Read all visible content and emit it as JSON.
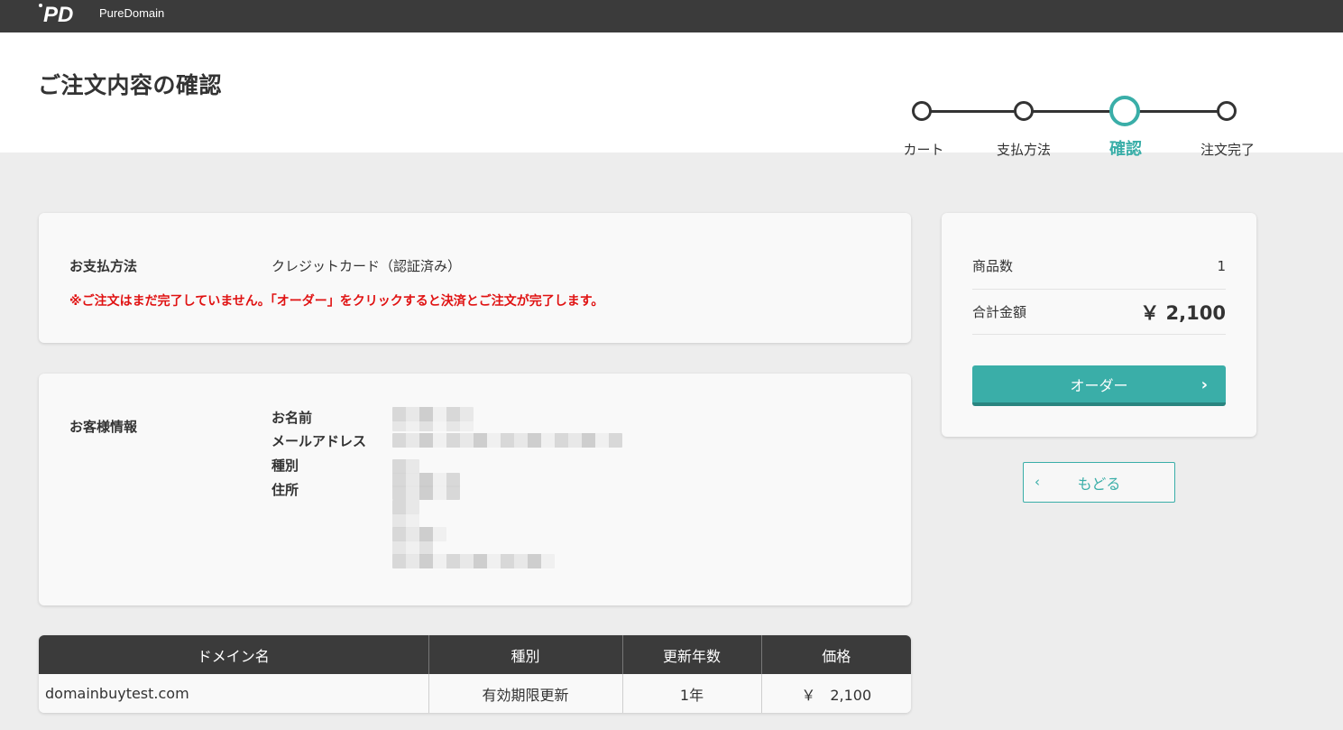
{
  "brand": {
    "logo_text": "PureDomain"
  },
  "header": {
    "title": "ご注文内容の確認"
  },
  "steps": [
    {
      "label": "カート",
      "active": false
    },
    {
      "label": "支払方法",
      "active": false
    },
    {
      "label": "確認",
      "active": true
    },
    {
      "label": "注文完了",
      "active": false
    }
  ],
  "payment": {
    "label": "お支払方法",
    "value": "クレジットカード（認証済み）",
    "warning": "※ご注文はまだ完了していません。「オーダー」をクリックすると決済とご注文が完了します。"
  },
  "customer": {
    "section_label": "お客様情報",
    "fields": {
      "name": "お名前",
      "email": "メールアドレス",
      "type": "種別",
      "address": "住所"
    }
  },
  "domain_table": {
    "headers": [
      "ドメイン名",
      "種別",
      "更新年数",
      "価格"
    ],
    "rows": [
      [
        "domainbuytest.com",
        "有効期限更新",
        "1年",
        "￥　2,100"
      ]
    ]
  },
  "summary": {
    "item_count_label": "商品数",
    "item_count": "1",
    "total_label": "合計金額",
    "total": "￥ 2,100",
    "order_button": "オーダー",
    "back_button": "もどる"
  },
  "colors": {
    "accent": "#3aaea8",
    "topbar": "#3b3b3b",
    "warning": "#e01212"
  }
}
